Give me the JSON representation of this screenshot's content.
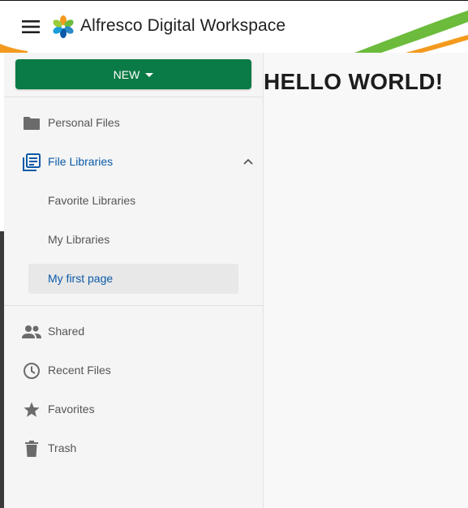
{
  "header": {
    "app_title": "Alfresco Digital Workspace",
    "menu_icon": "hamburger-menu-icon",
    "logo": "alfresco-logo",
    "accent_colors": [
      "#6cbb3c",
      "#f39a1e"
    ]
  },
  "sidebar": {
    "new_button_label": "NEW",
    "items": [
      {
        "label": "Personal Files",
        "icon": "folder-icon"
      },
      {
        "label": "File Libraries",
        "icon": "library-icon",
        "active": true,
        "expanded": true
      },
      {
        "label": "Shared",
        "icon": "people-icon"
      },
      {
        "label": "Recent Files",
        "icon": "clock-icon"
      },
      {
        "label": "Favorites",
        "icon": "star-icon"
      },
      {
        "label": "Trash",
        "icon": "trash-icon"
      }
    ],
    "libraries_children": [
      {
        "label": "Favorite Libraries"
      },
      {
        "label": "My Libraries"
      },
      {
        "label": "My first page",
        "selected": true
      }
    ]
  },
  "main": {
    "heading": "HELLO WORLD!"
  },
  "colors": {
    "primary_button": "#0a7a46",
    "active_text": "#0b5aa8",
    "sidebar_bg": "#f5f5f5"
  }
}
